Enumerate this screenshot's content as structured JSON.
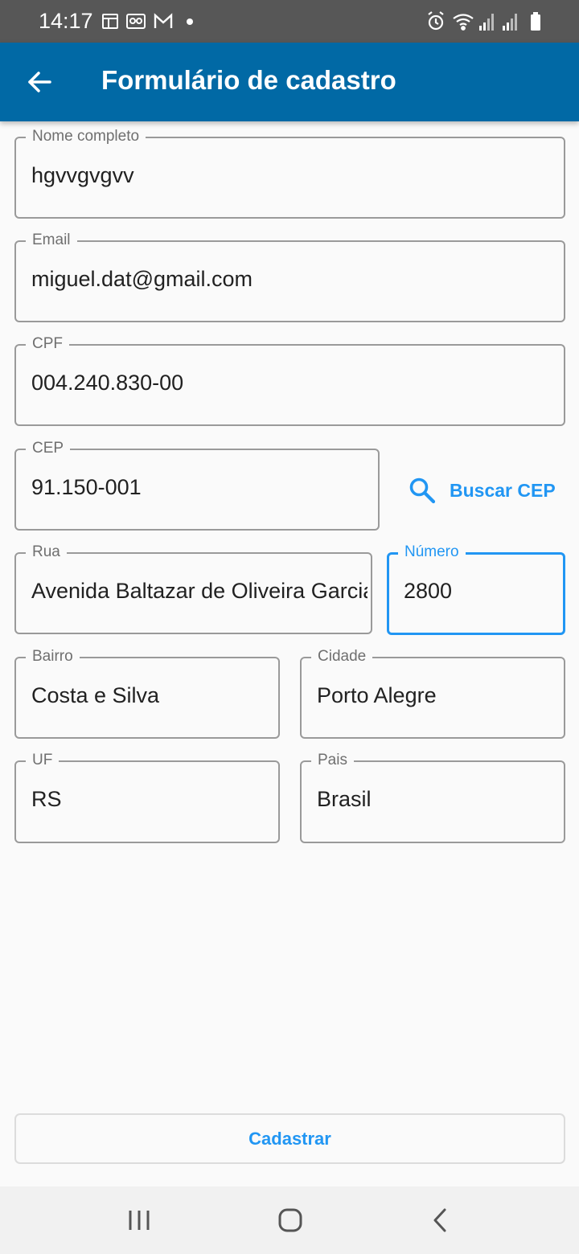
{
  "status_bar": {
    "time": "14:17",
    "left_icons": [
      "calendar-icon",
      "voicemail-icon",
      "gmail-icon",
      "dot-icon"
    ],
    "right_icons": [
      "alarm-icon",
      "wifi-icon",
      "signal-icon",
      "signal-icon",
      "battery-icon"
    ]
  },
  "app_bar": {
    "title": "Formulário de cadastro",
    "back_icon": "arrow-back-icon",
    "background": "#0169a5"
  },
  "form": {
    "nome": {
      "label": "Nome completo",
      "value": "hgvvgvgvv"
    },
    "email": {
      "label": "Email",
      "value": "miguel.dat@gmail.com"
    },
    "cpf": {
      "label": "CPF",
      "value": "004.240.830-00"
    },
    "cep": {
      "label": "CEP",
      "value": "91.150-001"
    },
    "buscar_cep": {
      "label": "Buscar CEP",
      "icon": "search-icon"
    },
    "rua": {
      "label": "Rua",
      "value": "Avenida Baltazar de Oliveira Garcia"
    },
    "numero": {
      "label": "Número",
      "value": "2800",
      "focused": true
    },
    "bairro": {
      "label": "Bairro",
      "value": "Costa e Silva"
    },
    "cidade": {
      "label": "Cidade",
      "value": "Porto Alegre"
    },
    "uf": {
      "label": "UF",
      "value": "RS"
    },
    "pais": {
      "label": "Pais",
      "value": "Brasil"
    },
    "submit_label": "Cadastrar"
  },
  "colors": {
    "accent": "#2196f3",
    "border": "#9a9a9a"
  },
  "nav_bar": {
    "buttons": [
      "recents-icon",
      "home-icon",
      "back-icon"
    ]
  }
}
